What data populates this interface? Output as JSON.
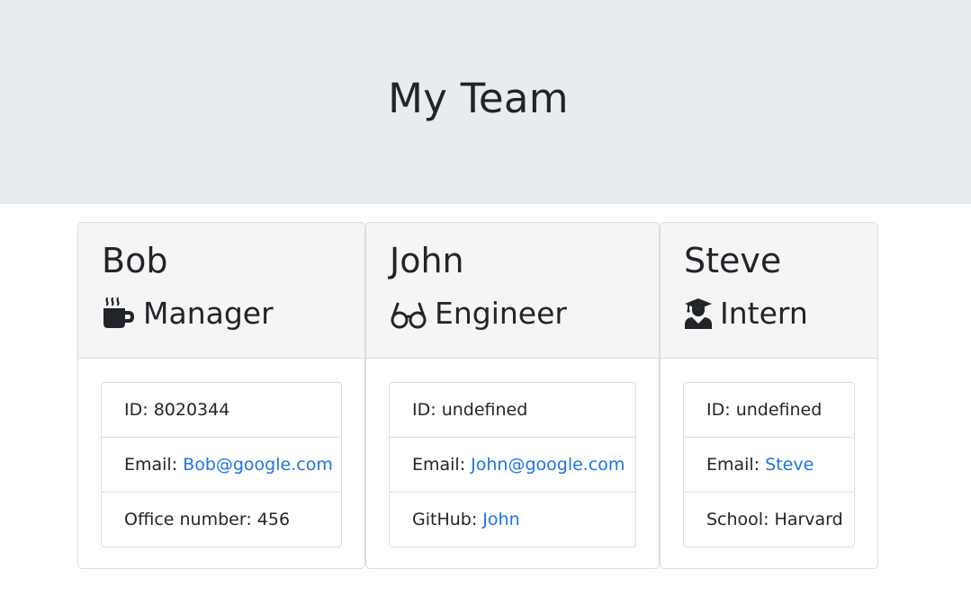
{
  "header": {
    "title": "My Team"
  },
  "colors": {
    "jumbotron": "#e9ecef",
    "card_header": "#f5f5f5",
    "link": "#1e73e8"
  },
  "cards": [
    {
      "name": "Bob",
      "role": "Manager",
      "icon": "mug-icon",
      "id_label": "ID: ",
      "id_value": "8020344",
      "email_label": "Email: ",
      "email_value": "Bob@google.com",
      "extra_label": "Office number: ",
      "extra_value": "456"
    },
    {
      "name": "John",
      "role": "Engineer",
      "icon": "glasses-icon",
      "id_label": "ID: ",
      "id_value": "undefined",
      "email_label": "Email: ",
      "email_value": "John@google.com",
      "extra_label": "GitHub: ",
      "extra_value": "John"
    },
    {
      "name": "Steve",
      "role": "Intern",
      "icon": "graduate-icon",
      "id_label": "ID: ",
      "id_value": "undefined",
      "email_label": "Email: ",
      "email_value": "Steve",
      "extra_label": "School: ",
      "extra_value": "Harvard"
    }
  ]
}
